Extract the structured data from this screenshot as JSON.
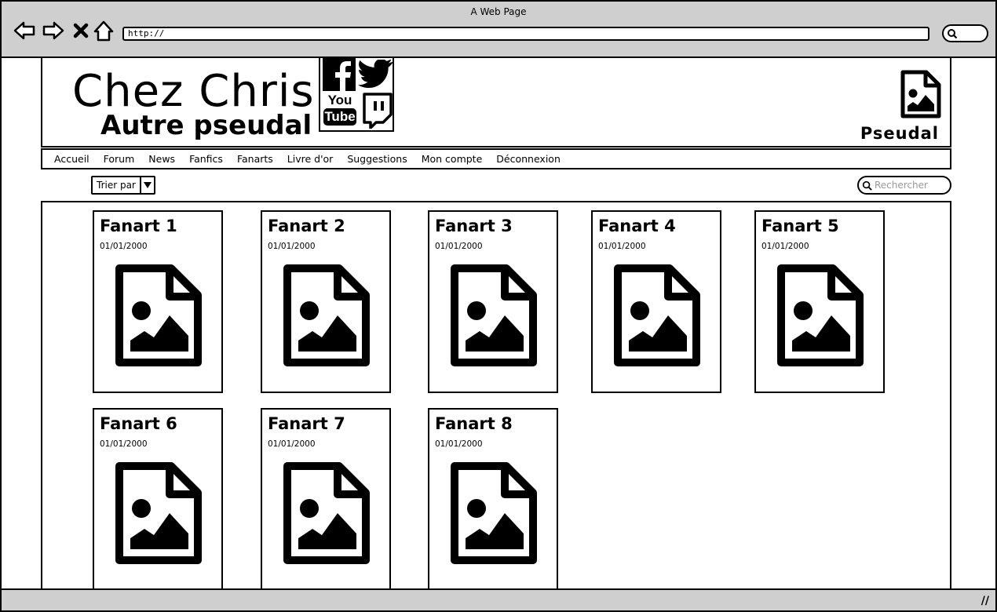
{
  "window": {
    "title": "A Web Page",
    "url": "http://"
  },
  "site": {
    "title": "Chez Chris",
    "subtitle": "Autre pseudal",
    "user": "Pseudal",
    "social": [
      "facebook-icon",
      "twitter-icon",
      "youtube-icon",
      "twitch-icon"
    ],
    "social_text": {
      "you": "You",
      "tube": "Tube"
    }
  },
  "menu": [
    "Accueil",
    "Forum",
    "News",
    "Fanfics",
    "Fanarts",
    "Livre d'or",
    "Suggestions",
    "Mon compte",
    "Déconnexion"
  ],
  "toolbar": {
    "sort_label": "Trier par",
    "search_placeholder": "Rechercher"
  },
  "fanarts": [
    {
      "title": "Fanart 1",
      "date": "01/01/2000"
    },
    {
      "title": "Fanart 2",
      "date": "01/01/2000"
    },
    {
      "title": "Fanart 3",
      "date": "01/01/2000"
    },
    {
      "title": "Fanart 4",
      "date": "01/01/2000"
    },
    {
      "title": "Fanart 5",
      "date": "01/01/2000"
    },
    {
      "title": "Fanart 6",
      "date": "01/01/2000"
    },
    {
      "title": "Fanart 7",
      "date": "01/01/2000"
    },
    {
      "title": "Fanart 8",
      "date": "01/01/2000"
    }
  ]
}
